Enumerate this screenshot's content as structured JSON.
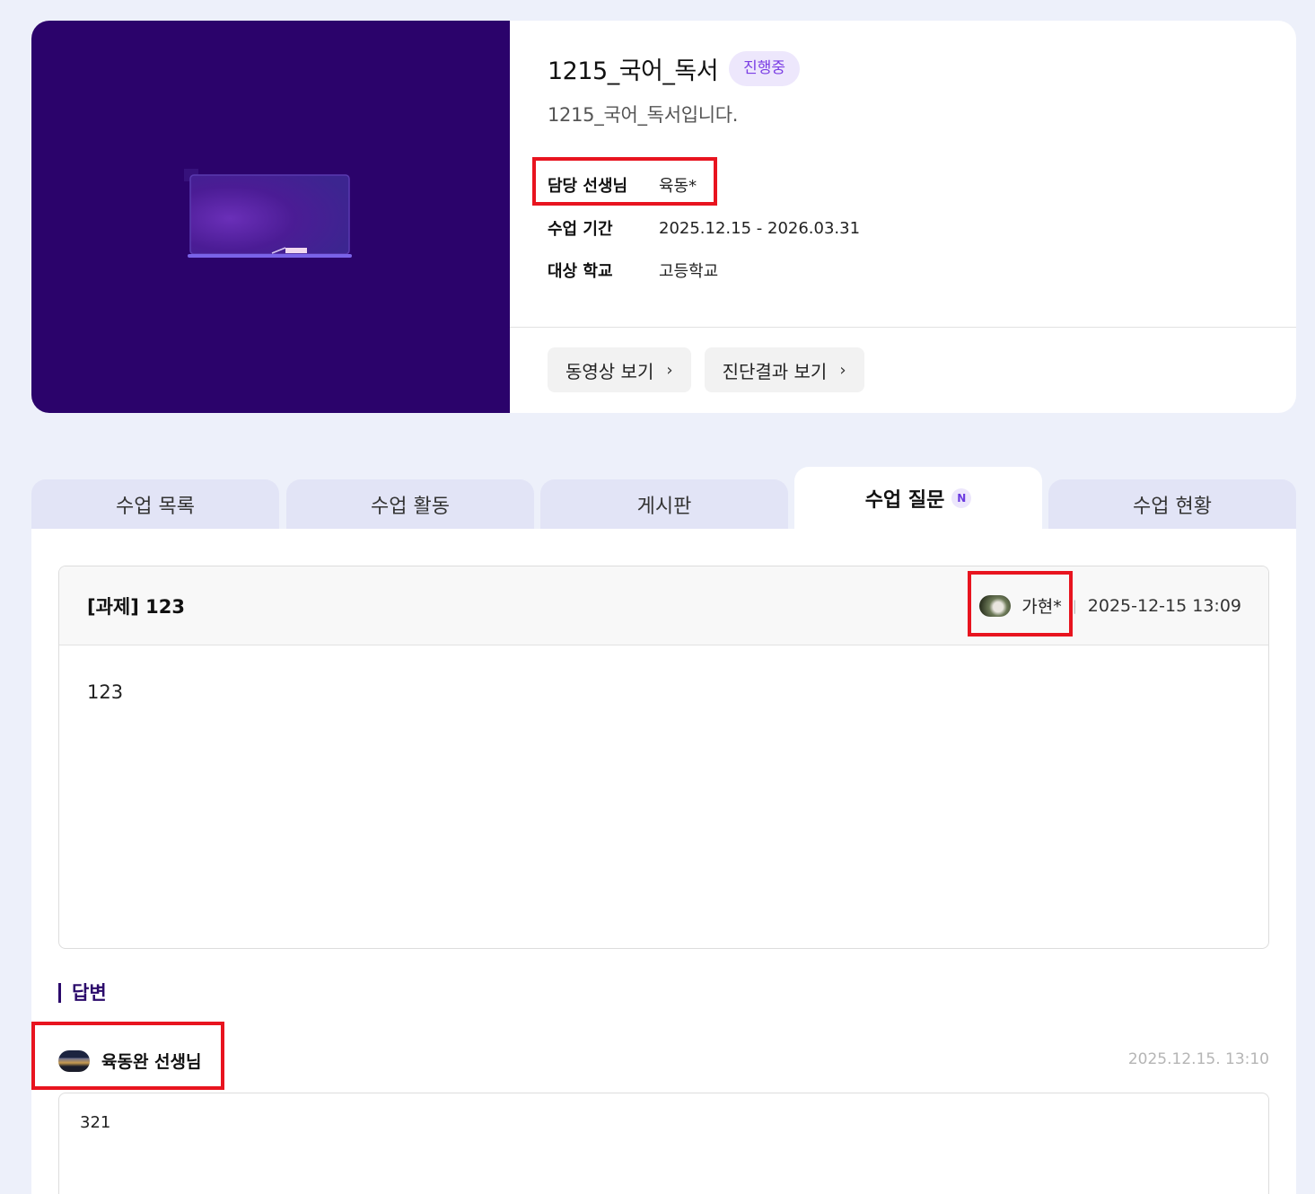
{
  "course": {
    "title": "1215_국어_독서",
    "status": "진행중",
    "description": "1215_국어_독서입니다.",
    "meta": [
      {
        "label": "담당 선생님",
        "value": "육동*"
      },
      {
        "label": "수업 기간",
        "value": "2025.12.15 - 2026.03.31"
      },
      {
        "label": "대상 학교",
        "value": "고등학교"
      }
    ],
    "buttons": [
      {
        "label": "동영상 보기",
        "icon": "chevron-right-icon"
      },
      {
        "label": "진단결과 보기",
        "icon": "chevron-right-icon"
      }
    ],
    "thumb_color": "#2b036b"
  },
  "tabs": [
    {
      "label": "수업 목록",
      "active": false
    },
    {
      "label": "수업 활동",
      "active": false
    },
    {
      "label": "게시판",
      "active": false
    },
    {
      "label": "수업 질문",
      "active": true,
      "badge": "N"
    },
    {
      "label": "수업 현황",
      "active": false
    }
  ],
  "question": {
    "title": "[과제] 123",
    "author": "가현*",
    "separator": "|",
    "datetime": "2025-12-15 13:09",
    "body": "123"
  },
  "answer": {
    "section_label": "답변",
    "author": "육동완 선생님",
    "datetime": "2025.12.15. 13:10",
    "body": "321"
  },
  "colors": {
    "accent": "#7b3fe4",
    "highlight": "#e8141f",
    "background": "#edf0fa"
  }
}
